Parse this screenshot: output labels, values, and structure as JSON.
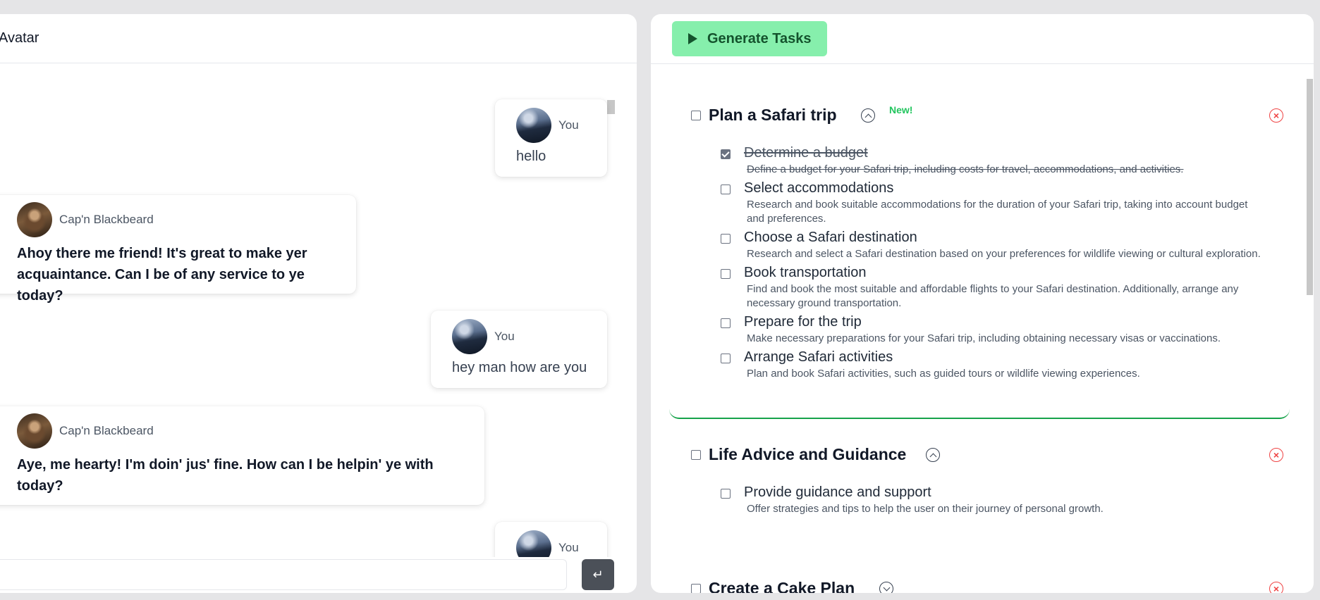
{
  "chat": {
    "header_title": "Avatar",
    "messages": [
      {
        "sender": "You",
        "text": "hello"
      },
      {
        "sender": "Cap'n Blackbeard",
        "text": "Ahoy there me friend! It's great to make yer acquaintance. Can I be of any service to ye today?"
      },
      {
        "sender": "You",
        "text": "hey man how are you"
      },
      {
        "sender": "Cap'n Blackbeard",
        "text": "Aye, me hearty! I'm doin' jus' fine. How can I be helpin' ye with today?"
      },
      {
        "sender": "You",
        "text": ""
      }
    ],
    "input_value": "",
    "send_icon": "enter-icon",
    "send_glyph": "↵"
  },
  "tasks": {
    "generate_label": "Generate Tasks",
    "plans": [
      {
        "title": "Plan a Safari trip",
        "badge": "New!",
        "expanded": true,
        "tasks": [
          {
            "title": "Determine a budget",
            "desc": "Define a budget for your Safari trip, including costs for travel, accommodations, and activities.",
            "done": true
          },
          {
            "title": "Select accommodations",
            "desc": "Research and book suitable accommodations for the duration of your Safari trip, taking into account budget and preferences.",
            "done": false
          },
          {
            "title": "Choose a Safari destination",
            "desc": "Research and select a Safari destination based on your preferences for wildlife viewing or cultural exploration.",
            "done": false
          },
          {
            "title": "Book transportation",
            "desc": "Find and book the most suitable and affordable flights to your Safari destination. Additionally, arrange any necessary ground transportation.",
            "done": false
          },
          {
            "title": "Prepare for the trip",
            "desc": "Make necessary preparations for your Safari trip, including obtaining necessary visas or vaccinations.",
            "done": false
          },
          {
            "title": "Arrange Safari activities",
            "desc": "Plan and book Safari activities, such as guided tours or wildlife viewing experiences.",
            "done": false
          }
        ]
      },
      {
        "title": "Life Advice and Guidance",
        "expanded": true,
        "tasks": [
          {
            "title": "Provide guidance and support",
            "desc": "Offer strategies and tips to help the user on their journey of personal growth.",
            "done": false
          }
        ]
      },
      {
        "title": "Create a Cake Plan",
        "expanded": false,
        "tasks": []
      }
    ],
    "close_glyph": "×",
    "accent_color": "#16a34a",
    "button_color": "#86efac",
    "delete_color": "#ef4444"
  }
}
